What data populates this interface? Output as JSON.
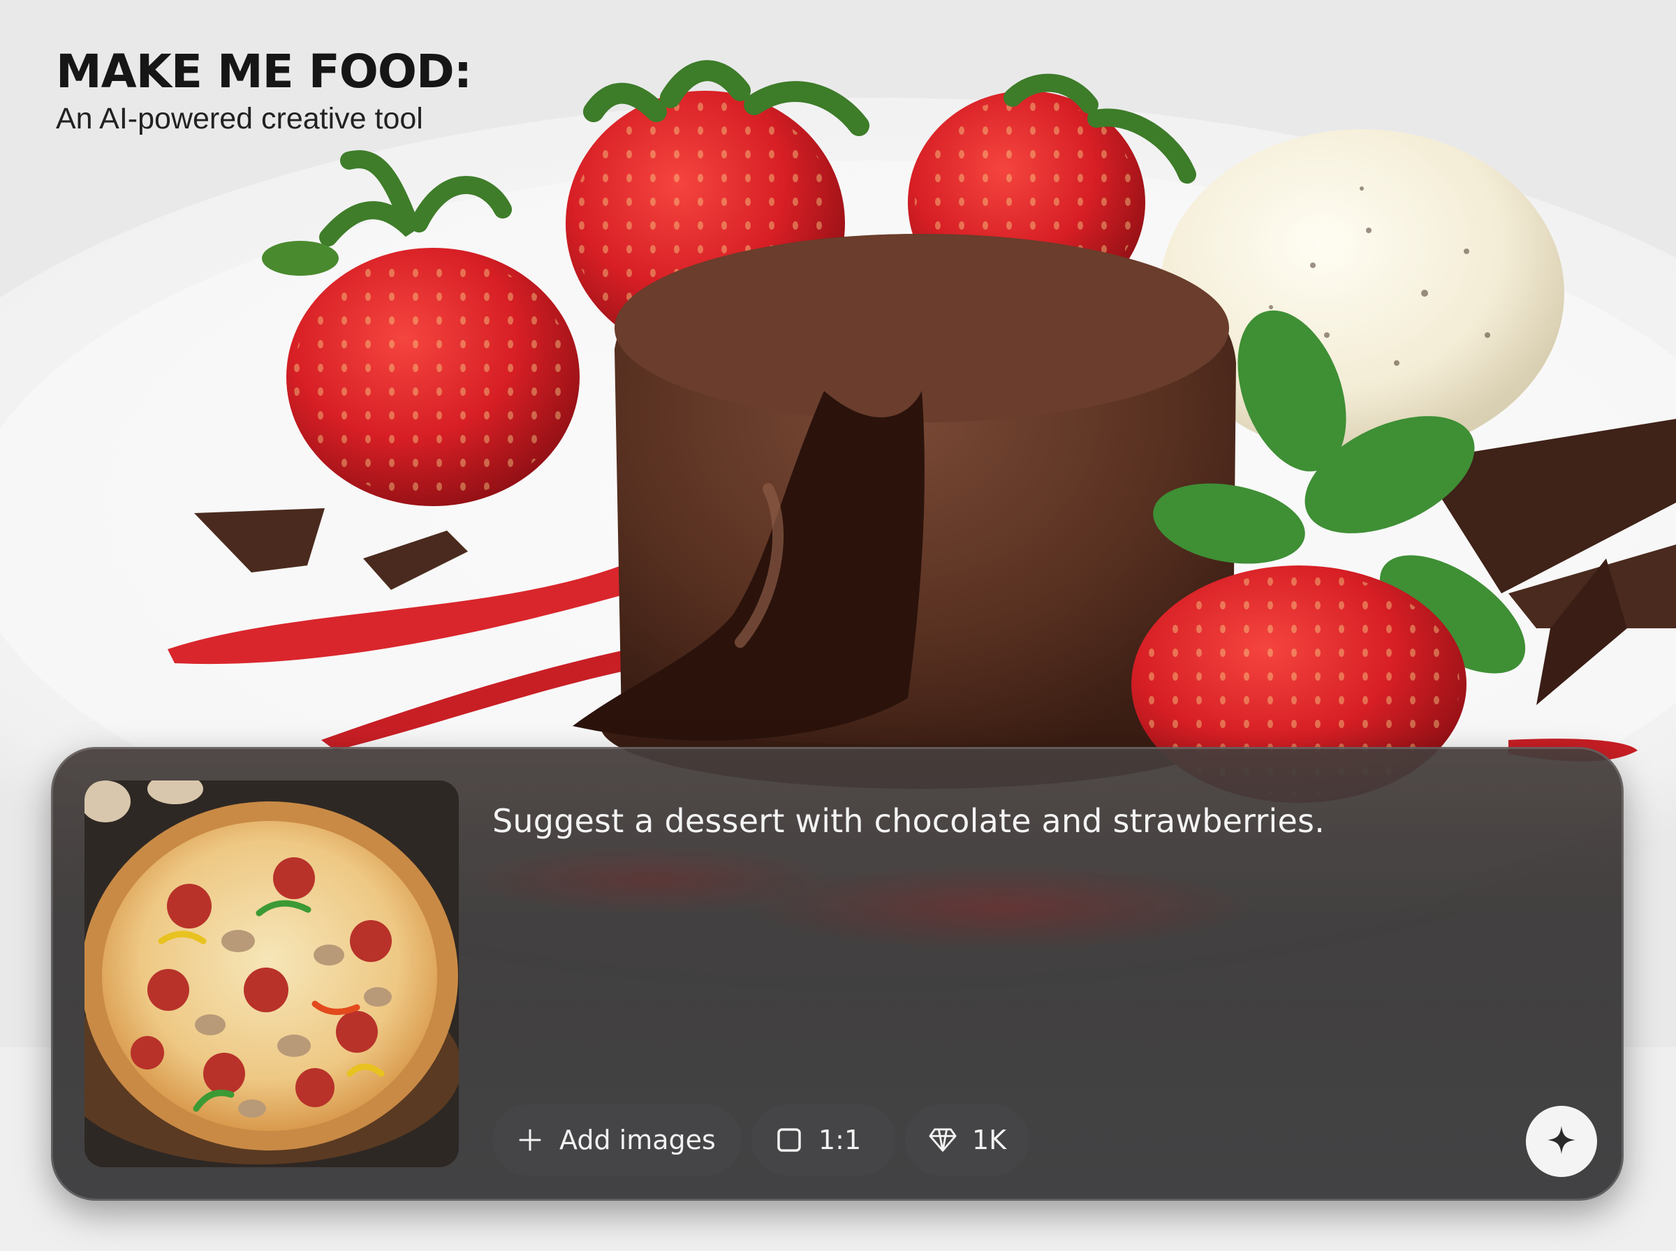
{
  "header": {
    "title": "MAKE ME FOOD:",
    "subtitle": "An AI-powered creative tool"
  },
  "background": {
    "icon": "chocolate-lava-cake-dessert-photo"
  },
  "prompt_panel": {
    "thumbnail_icon": "pizza-photo",
    "prompt_text": "Suggest a dessert with chocolate and strawberries.",
    "controls": {
      "add_images_label": "Add images",
      "add_icon": "plus-icon",
      "aspect_ratio_label": "1:1",
      "aspect_icon": "square-icon",
      "quality_label": "1K",
      "quality_icon": "diamond-icon"
    },
    "generate_icon": "sparkle-icon"
  },
  "colors": {
    "panel_bg": "#3c3c3e",
    "pill_bg": "#464648",
    "text_light": "#f4f4f4",
    "title_dark": "#161616",
    "strawberry": "#d8202a",
    "chocolate": "#5a3222"
  }
}
